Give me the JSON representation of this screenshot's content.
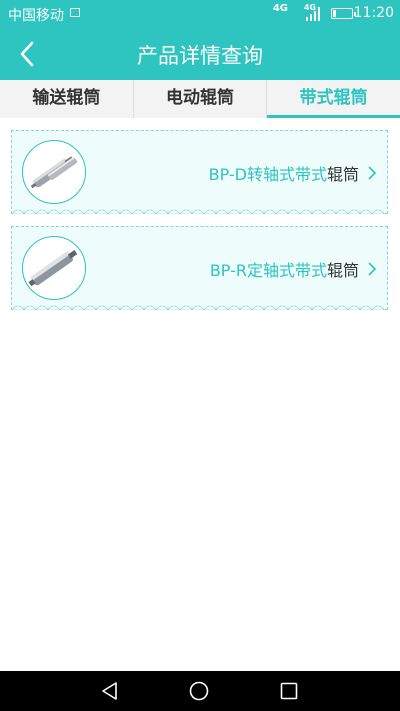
{
  "status_bar": {
    "carrier": "中国移动",
    "network_primary": "4G",
    "network_secondary": "4G",
    "battery_level": 0.15,
    "time": "11:20"
  },
  "header": {
    "title": "产品详情查询",
    "back_icon": "chevron-left-icon"
  },
  "tabs": [
    {
      "label": "输送辊筒",
      "active": false
    },
    {
      "label": "电动辊筒",
      "active": false
    },
    {
      "label": "带式辊筒",
      "active": true
    }
  ],
  "products": [
    {
      "name_accent": "BP-D转轴式带式",
      "name_plain": "辊筒",
      "image": "roller-product-image"
    },
    {
      "name_accent": "BP-R定轴式带式",
      "name_plain": "辊筒",
      "image": "roller-product-image"
    }
  ],
  "colors": {
    "accent": "#2ec4bf",
    "card_background": "#eefcfc",
    "tab_bar_background": "#f3f3f3",
    "nav_bar_background": "#000000"
  }
}
